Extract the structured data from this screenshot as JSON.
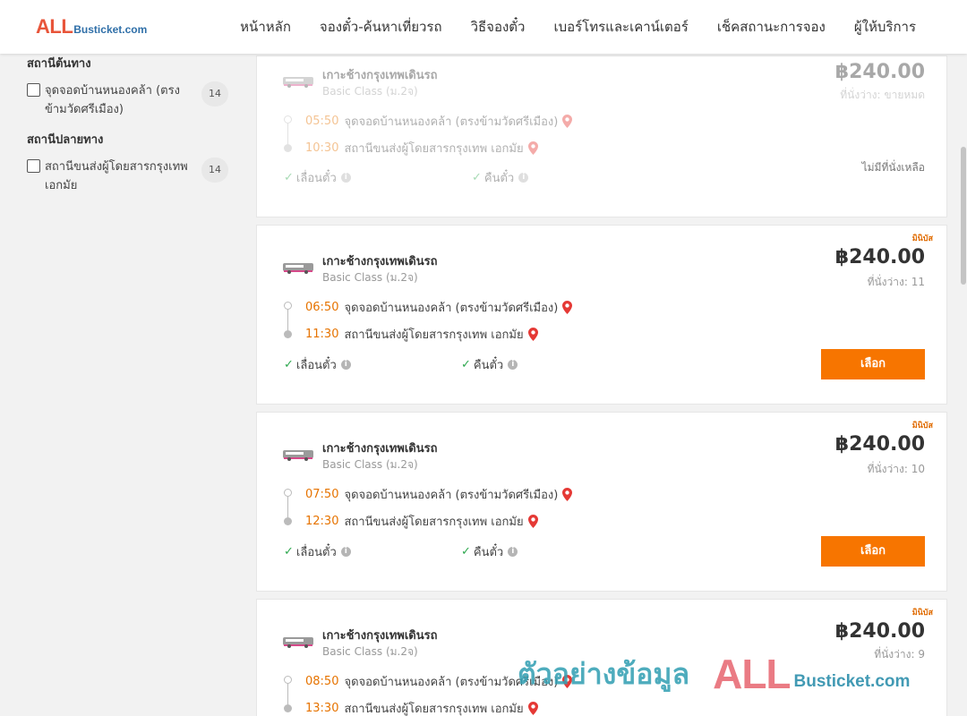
{
  "header": {
    "logo_all": "ALL",
    "logo_rest": "Busticket.com",
    "nav": [
      "หน้าหลัก",
      "จองตั๋ว-ค้นหาเที่ยวรถ",
      "วิธีจองตั๋ว",
      "เบอร์โทรและเคาน์เตอร์",
      "เช็คสถานะการจอง",
      "ผู้ให้บริการ"
    ]
  },
  "sidebar": {
    "origin_title": "สถานีต้นทาง",
    "origin_option": "จุดจอดบ้านหนองคล้า (ตรงข้ามวัดศรีเมือง)",
    "origin_count": "14",
    "dest_title": "สถานีปลายทาง",
    "dest_option": "สถานีขนส่งผู้โดยสารกรุงเทพ เอกมัย",
    "dest_count": "14"
  },
  "common": {
    "company": "เกาะช้างกรุงเทพเดินรถ",
    "bus_class": "Basic Class (ม.2จ)",
    "origin_stop": "จุดจอดบ้านหนองคล้า (ตรงข้ามวัดศรีเมือง)",
    "dest_stop": "สถานีขนส่งผู้โดยสารกรุงเทพ เอกมัย",
    "feature_change": "เลื่อนตั๋ว",
    "feature_refund": "คืนตั๋ว",
    "minibus": "มินิบัส",
    "select_label": "เลือก",
    "price": "฿240.00",
    "sold_out_note": "ไม่มีที่นั่งเหลือ"
  },
  "trips": [
    {
      "depart": "05:50",
      "arrive": "10:30",
      "seats": "ที่นั่งว่าง: ขายหมด"
    },
    {
      "depart": "06:50",
      "arrive": "11:30",
      "seats": "ที่นั่งว่าง: 11"
    },
    {
      "depart": "07:50",
      "arrive": "12:30",
      "seats": "ที่นั่งว่าง: 10"
    },
    {
      "depart": "08:50",
      "arrive": "13:30",
      "seats": "ที่นั่งว่าง: 9"
    }
  ],
  "watermark": {
    "text": "ตัวอย่างข้อมูล",
    "all": "ALL",
    "rest": "Busticket.com"
  },
  "colors": {
    "accent_orange": "#f77500",
    "time_orange": "#e67300",
    "check_green": "#2ea84f",
    "pin_red": "#e53935"
  }
}
